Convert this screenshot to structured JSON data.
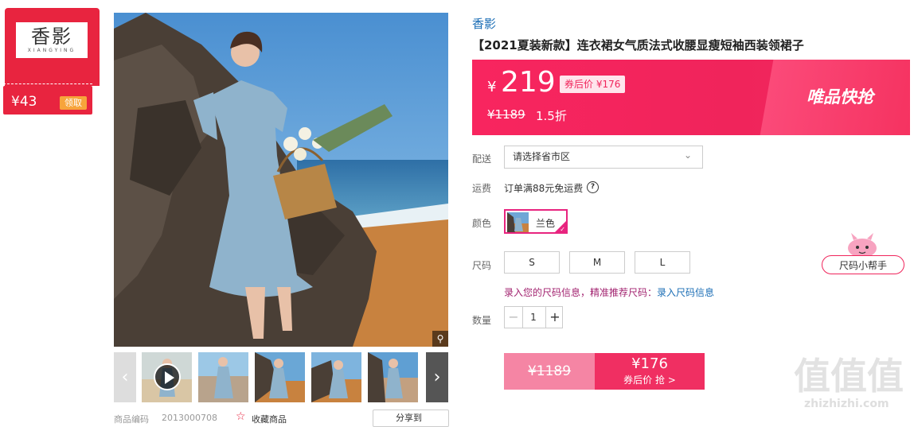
{
  "brand_card": {
    "logo_text": "香影",
    "logo_sub": "XIANGYING",
    "coupon_amount": "¥43",
    "coupon_claim_label": "领取"
  },
  "gallery": {
    "zoom_icon": "magnifier-icon",
    "prev_icon": "chevron-left-icon",
    "next_icon": "chevron-right-icon",
    "play_icon": "play-icon"
  },
  "meta": {
    "sku_label": "商品编码",
    "sku_value": "2013000708",
    "favorite_label": "收藏商品",
    "share_label": "分享到"
  },
  "product": {
    "brand": "香影",
    "title": "【2021夏装新款】连衣裙女气质法式收腰显瘦短袖西装领裙子"
  },
  "price": {
    "currency": "¥",
    "current": "219",
    "after_coupon": "券后价 ¥176",
    "original": "¥1189",
    "discount": "1.5折",
    "flash_sale": "唯品快抢"
  },
  "delivery": {
    "label": "配送",
    "select_value": "请选择省市区"
  },
  "shipping": {
    "label": "运费",
    "text": "订单满88元免运费"
  },
  "color": {
    "label": "颜色",
    "selected": "兰色"
  },
  "size": {
    "label": "尺码",
    "options": [
      "S",
      "M",
      "L"
    ],
    "tip_text": "录入您的尺码信息，精准推荐尺码：",
    "tip_link": "录入尺码信息"
  },
  "quantity": {
    "label": "数量",
    "minus": "−",
    "value": "1",
    "plus": "+"
  },
  "buy": {
    "original_price": "¥1189",
    "coupon_price": "¥176",
    "coupon_label": "券后价 抢 >"
  },
  "size_helper": {
    "label": "尺码小帮手"
  },
  "watermark": {
    "text": "值值值",
    "site": "zhizhizhi.com"
  },
  "colors": {
    "accent": "#f0245b",
    "brand_red": "#e8243f",
    "link_blue": "#1a6db5"
  }
}
